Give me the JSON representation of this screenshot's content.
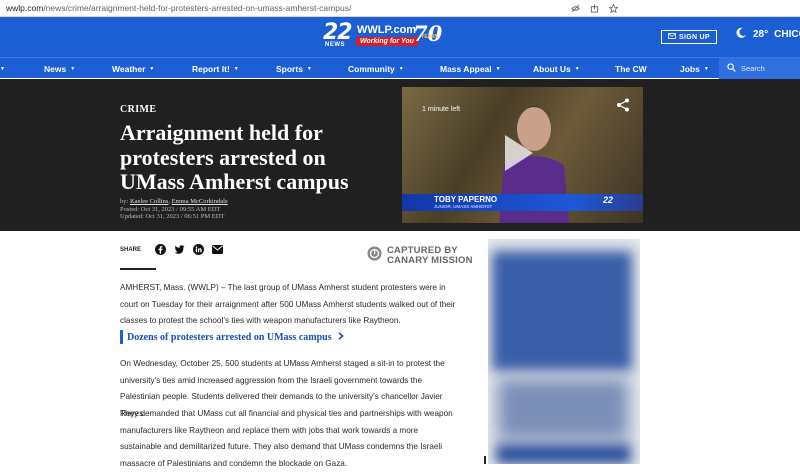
{
  "browser": {
    "url_domain": "wwlp.com",
    "url_path": "/news/crime/arraignment-held-for-protesters-arrested-on-umass-amherst-campus/"
  },
  "header": {
    "logo": {
      "channel": "22",
      "news": "NEWS",
      "site": "WWLP.com",
      "tagline": "Working for You",
      "anniversary": "70",
      "anniversary_sub": "YEARS"
    },
    "signup_label": "SIGN UP",
    "weather": {
      "temp": "28°",
      "city": "CHICOP"
    },
    "colors": {
      "brand_blue": "#1c5fd4",
      "hero_bg": "#202020"
    }
  },
  "nav": {
    "items": [
      {
        "label": "News",
        "dropdown": true
      },
      {
        "label": "Weather",
        "dropdown": true
      },
      {
        "label": "Report It!",
        "dropdown": true
      },
      {
        "label": "Sports",
        "dropdown": true
      },
      {
        "label": "Community",
        "dropdown": true
      },
      {
        "label": "Mass Appeal",
        "dropdown": true
      },
      {
        "label": "About Us",
        "dropdown": true
      },
      {
        "label": "The CW",
        "dropdown": false
      },
      {
        "label": "Jobs",
        "dropdown": true
      }
    ],
    "search_placeholder": "Search"
  },
  "article": {
    "category": "CRIME",
    "headline": "Arraignment held for protesters arrested on UMass Amherst campus",
    "by_prefix": "by:",
    "author1": "Kaelee Collins",
    "author2": "Emma McCorkindale",
    "posted": "Posted: Oct 31, 2023 / 09:55 AM EDT",
    "updated": "Updated: Oct 31, 2023 / 06:51 PM EDT",
    "share_label": "SHARE",
    "share_icons": [
      "facebook-icon",
      "twitter-icon",
      "linkedin-icon",
      "email-icon"
    ],
    "captured_line1": "CAPTURED BY",
    "captured_line2": "CANARY MISSION",
    "p1": "AMHERST, Mass. (WWLP) – The last group of UMass Amherst student protesters were in court on Tuesday for their arraignment after 500 UMass Amherst students walked out of their classes to protest the school’s ties with weapon manufacturers like Raytheon.",
    "related_link": "Dozens of protesters arrested on UMass campus",
    "p2": "On Wednesday, October 25, 500 students at UMass Amherst staged a sit-in to protest the university’s ties amid increased aggression from the Israeli government towards the Palestinian people. Students delivered their demands to the university’s chancellor Javier Reyes.",
    "p3": "They demanded that UMass cut all financial and physical ties and partnerships with weapon manufacturers like Raytheon and replace them with jobs that work towards a more sustainable and demilitarized future. They also demand that UMass condemns the Israeli massacre of Palestinians and condemn the blockade on Gaza."
  },
  "video": {
    "time_left": "1 minute left",
    "lower_third_name": "TOBY PAPERNO",
    "lower_third_sub": "JUNIOR, UMASS AMHERST",
    "badge": "22"
  }
}
